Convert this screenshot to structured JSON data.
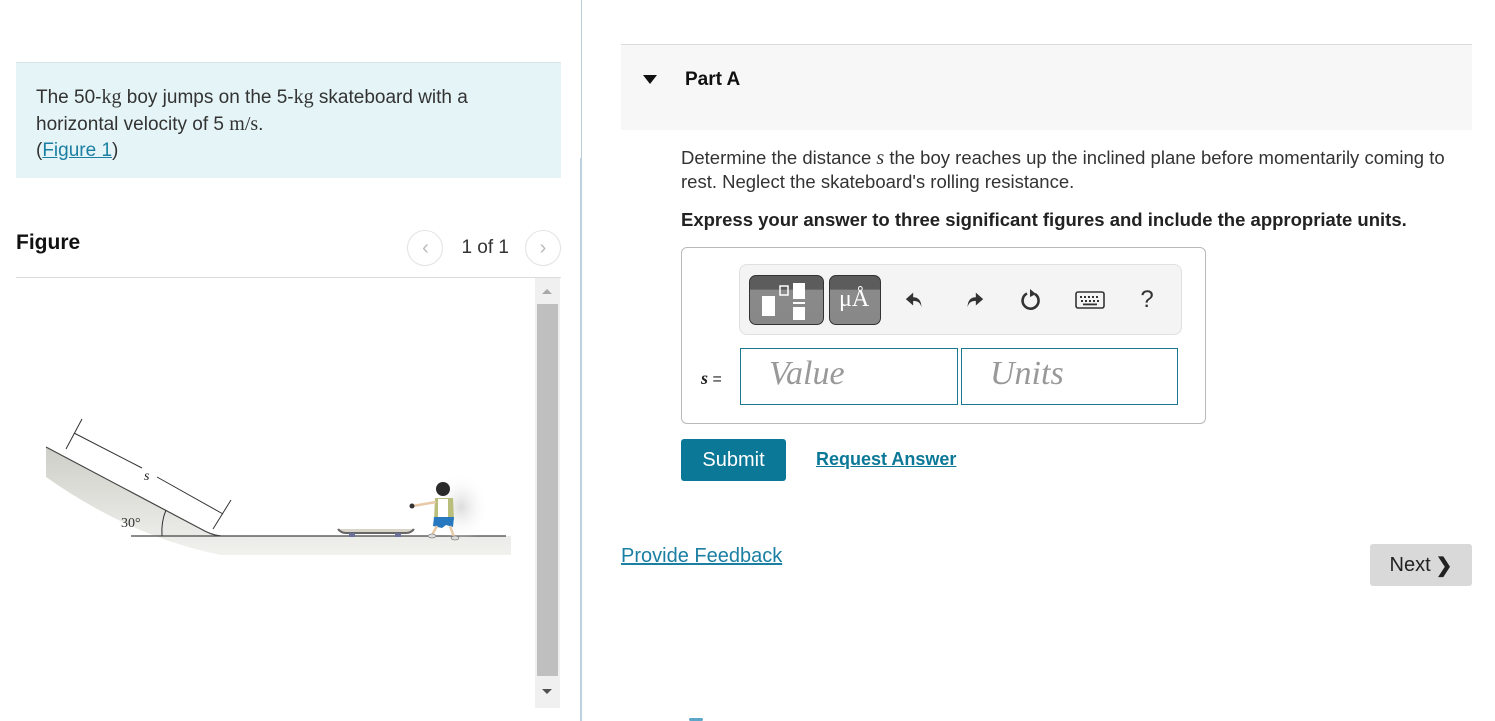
{
  "problem": {
    "intro_part1": "The 50-",
    "unit_kg_1": "kg",
    "intro_part2": " boy jumps on the 5-",
    "unit_kg_2": "kg",
    "intro_part3": " skateboard with a horizontal velocity of 5 ",
    "unit_velocity": "m/s",
    "intro_part4": ".",
    "figure_link_open": "(",
    "figure_link": "Figure 1",
    "figure_link_close": ")"
  },
  "figure": {
    "title": "Figure",
    "pager_text": "1 of 1",
    "prev_icon": "chevron-left-icon",
    "next_icon": "chevron-right-icon",
    "label_s": "s",
    "label_angle": "30°"
  },
  "part": {
    "title": "Part A",
    "question_part1": "Determine the distance ",
    "question_var": "s",
    "question_part2": " the boy reaches up the inclined plane before momentarily coming to rest. Neglect the skateboard's rolling resistance.",
    "instruction": "Express your answer to three significant figures and include the appropriate units."
  },
  "toolbar": {
    "templates_icon": "fraction-templates-icon",
    "units_label": "μÅ",
    "undo_icon": "undo-icon",
    "redo_icon": "redo-icon",
    "reset_icon": "reset-icon",
    "keyboard_icon": "keyboard-icon",
    "help_label": "?"
  },
  "answer": {
    "variable": "s",
    "equals": " =",
    "value_placeholder": "Value",
    "units_placeholder": "Units",
    "value": "",
    "units": ""
  },
  "actions": {
    "submit_label": "Submit",
    "request_answer_label": "Request Answer",
    "feedback_label": "Provide Feedback",
    "next_label": "Next",
    "next_chevron": "❯"
  },
  "colors": {
    "accent": "#0b7897",
    "link": "#1b7fa3",
    "intro_bg": "#e5f4f6",
    "next_bg": "#d9d9d9"
  }
}
